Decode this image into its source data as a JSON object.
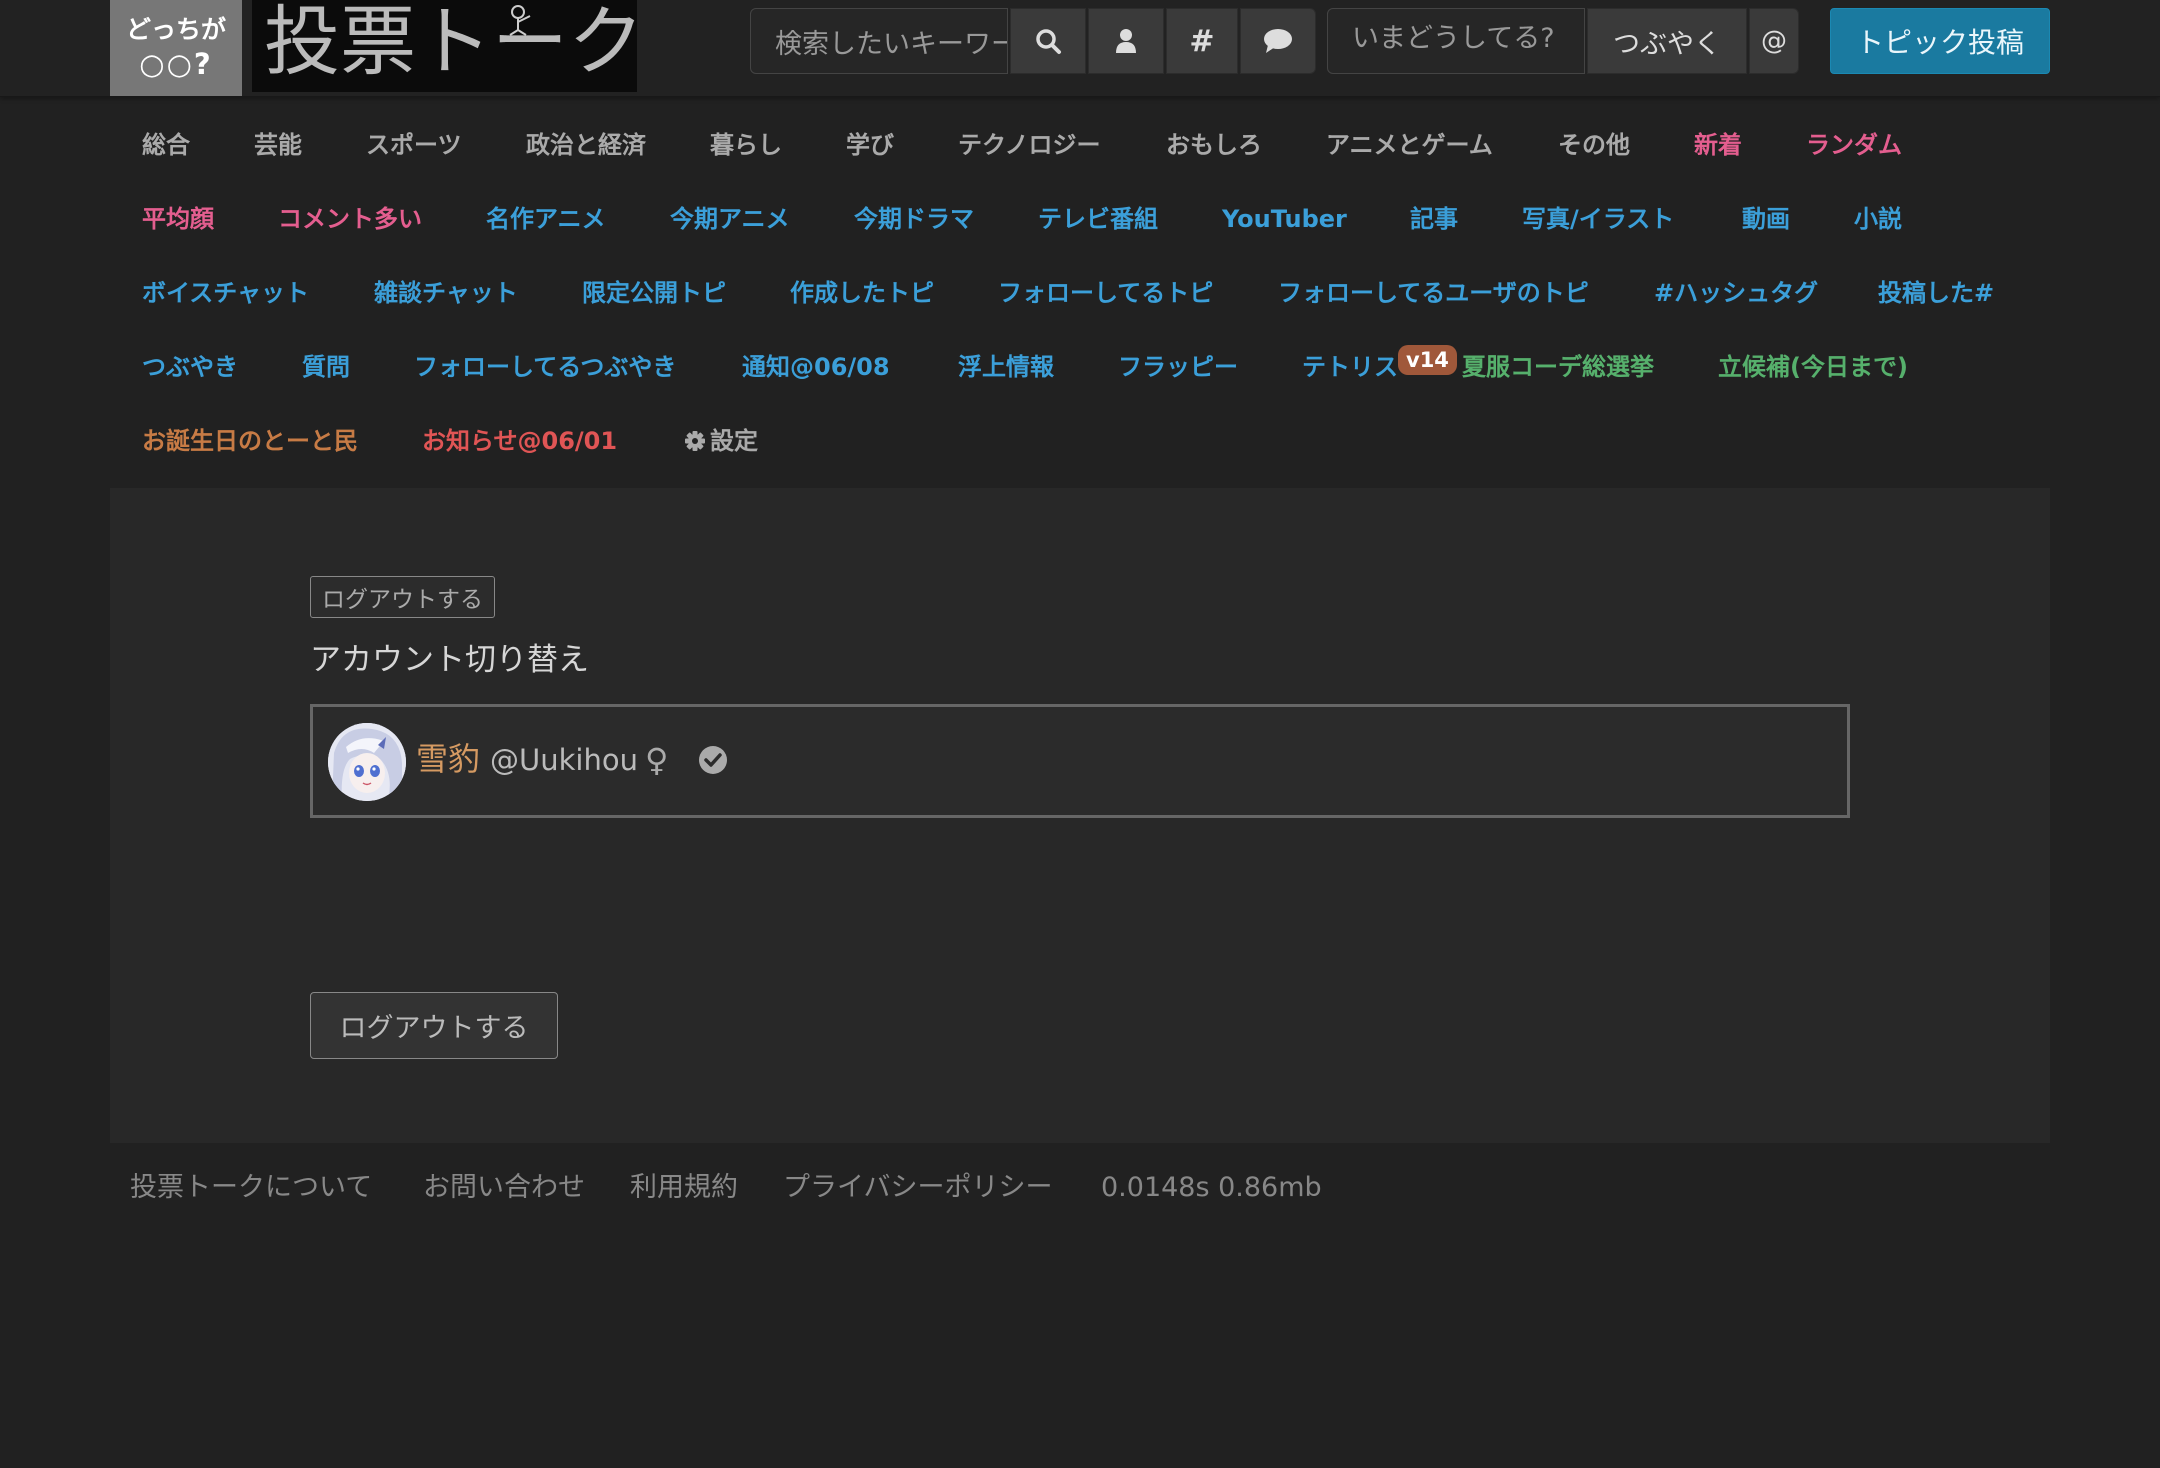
{
  "header": {
    "logo_line1": "どっちが",
    "logo_line2": "○○?",
    "site_title": "投票トーク",
    "search_placeholder": "検索したいキーワード",
    "tweet_placeholder": "いまどうしてる?",
    "tweet_button": "つぶやく",
    "mention_button": "@",
    "post_topic_button": "トピック投稿",
    "accent_color": "#1a7aa0"
  },
  "nav": {
    "row1": [
      "総合",
      "芸能",
      "スポーツ",
      "政治と経済",
      "暮らし",
      "学び",
      "テクノロジー",
      "おもしろ",
      "アニメとゲーム",
      "その他",
      "新着",
      "ランダム"
    ],
    "row2": [
      "平均顔",
      "コメント多い",
      "名作アニメ",
      "今期アニメ",
      "今期ドラマ",
      "テレビ番組",
      "YouTuber",
      "記事",
      "写真/イラスト",
      "動画",
      "小説"
    ],
    "row3": [
      "ボイスチャット",
      "雑談チャット",
      "限定公開トピ",
      "作成したトピ",
      "フォローしてるトピ",
      "フォローしてるユーザのトピ",
      "#ハッシュタグ",
      "投稿した#"
    ],
    "row4": [
      "つぶやき",
      "質問",
      "フォローしてるつぶやき",
      "通知@06/08",
      "浮上情報",
      "フラッピー",
      "テトリス",
      "夏服コーデ総選挙",
      "立候補(今日まで)"
    ],
    "tetris_badge": "v14",
    "row5": [
      "お誕生日のとーと民",
      "お知らせ@06/01",
      "設定"
    ]
  },
  "main": {
    "logout_small": "ログアウトする",
    "switch_title": "アカウント切り替え",
    "account": {
      "display_name": "雪豹",
      "handle": "@Uukihou"
    },
    "logout_big": "ログアウトする"
  },
  "footer": {
    "links": [
      "投票トークについて",
      "お問い合わせ",
      "利用規約",
      "プライバシーポリシー"
    ],
    "stats": "0.0148s 0.86mb"
  }
}
